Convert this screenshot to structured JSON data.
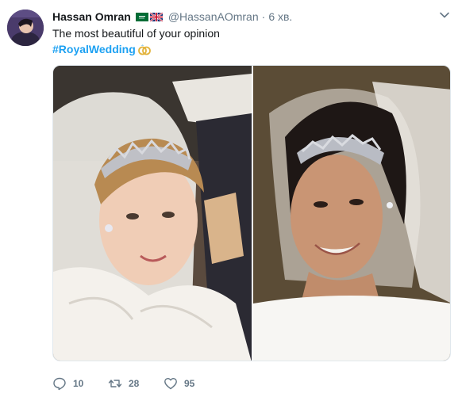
{
  "tweet": {
    "author_name": "Hassan Omran",
    "handle": "@HassanAOmran",
    "separator": "·",
    "time": "6 хв.",
    "text": "The most beautiful of your opinion",
    "hashtag": "#RoyalWedding"
  },
  "actions": {
    "reply_count": "10",
    "retweet_count": "28",
    "like_count": "95"
  },
  "icons": {
    "flags": [
      "saudi-arabia-flag-icon",
      "united-kingdom-flag-icon"
    ],
    "hashtag_emoji": "rings-icon"
  },
  "colors": {
    "link": "#1da1f2",
    "secondary_text": "#657786"
  }
}
